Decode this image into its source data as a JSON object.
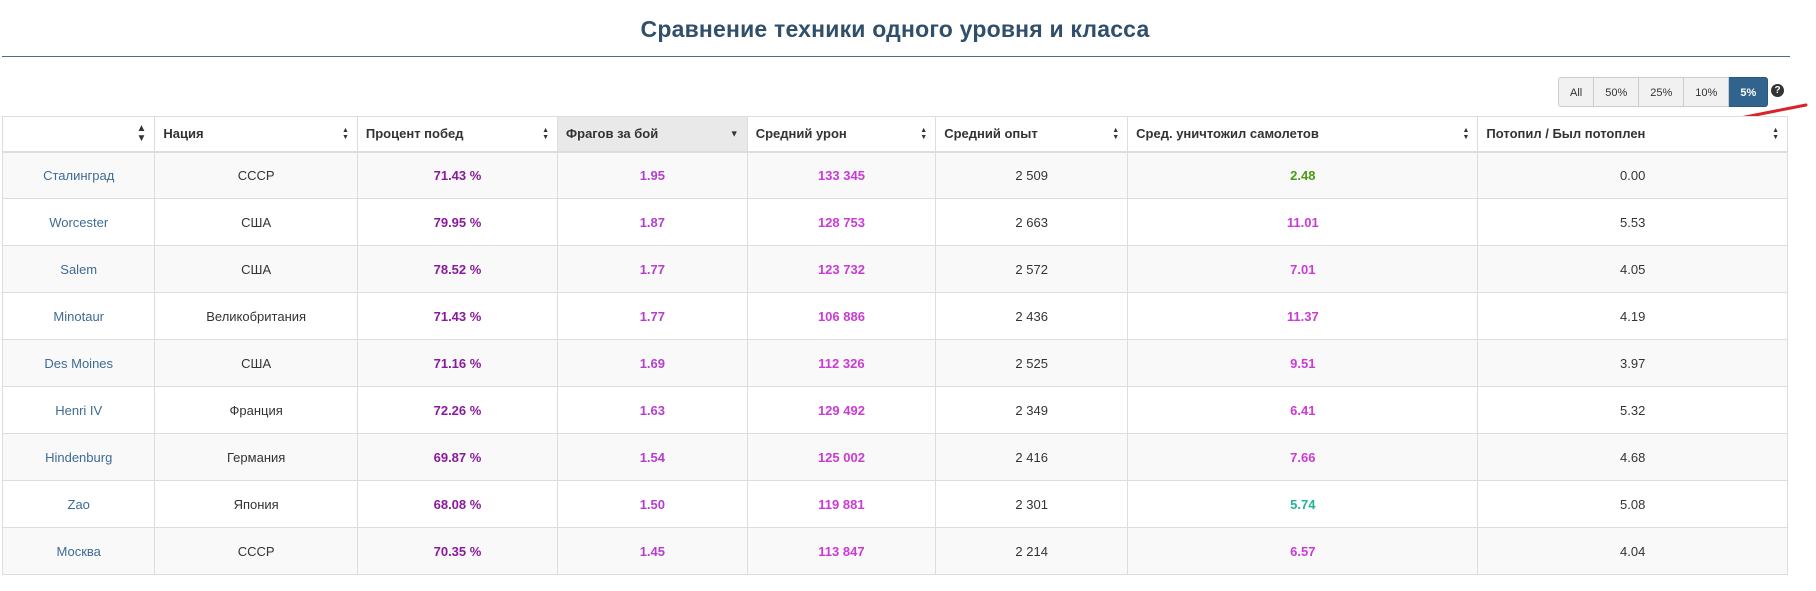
{
  "page": {
    "title": "Сравнение техники одного уровня и класса"
  },
  "filters": {
    "buttons": [
      {
        "label": "All",
        "active": false
      },
      {
        "label": "50%",
        "active": false
      },
      {
        "label": "25%",
        "active": false
      },
      {
        "label": "10%",
        "active": false
      },
      {
        "label": "5%",
        "active": true
      }
    ],
    "help_icon": "question-circle-icon",
    "help_glyph": "?"
  },
  "colors": {
    "title": "#2f4f6b",
    "active_filter": "#30648f",
    "winrate": "#8a1a9c",
    "frags": "#b53ecf",
    "damage": "#cc3ad6",
    "planes_green": "#4d9b12",
    "planes_teal": "#20b596",
    "planes_magenta": "#cc3ad6",
    "link": "#3d6b95",
    "annotation_mark": "#d8232a"
  },
  "table": {
    "headers": [
      {
        "label": "",
        "sort": "both"
      },
      {
        "label": "Нация",
        "sort": "both"
      },
      {
        "label": "Процент побед",
        "sort": "both"
      },
      {
        "label": "Фрагов за бой",
        "sort": "desc",
        "sorted": true
      },
      {
        "label": "Средний урон",
        "sort": "both"
      },
      {
        "label": "Средний опыт",
        "sort": "both"
      },
      {
        "label": "Сред. уничтожил самолетов",
        "sort": "both"
      },
      {
        "label": "Потопил / Был потоплен",
        "sort": "both"
      }
    ],
    "rows": [
      {
        "ship": "Сталинград",
        "nation": "СССР",
        "winrate": "71.43 %",
        "frags": "1.95",
        "damage": "133 345",
        "xp": "2 509",
        "planes": "2.48",
        "planes_color": "green",
        "kd": "0.00"
      },
      {
        "ship": "Worcester",
        "nation": "США",
        "winrate": "79.95 %",
        "frags": "1.87",
        "damage": "128 753",
        "xp": "2 663",
        "planes": "11.01",
        "planes_color": "magenta",
        "kd": "5.53"
      },
      {
        "ship": "Salem",
        "nation": "США",
        "winrate": "78.52 %",
        "frags": "1.77",
        "damage": "123 732",
        "xp": "2 572",
        "planes": "7.01",
        "planes_color": "magenta",
        "kd": "4.05"
      },
      {
        "ship": "Minotaur",
        "nation": "Великобритания",
        "winrate": "71.43 %",
        "frags": "1.77",
        "damage": "106 886",
        "xp": "2 436",
        "planes": "11.37",
        "planes_color": "magenta",
        "kd": "4.19"
      },
      {
        "ship": "Des Moines",
        "nation": "США",
        "winrate": "71.16 %",
        "frags": "1.69",
        "damage": "112 326",
        "xp": "2 525",
        "planes": "9.51",
        "planes_color": "magenta",
        "kd": "3.97"
      },
      {
        "ship": "Henri IV",
        "nation": "Франция",
        "winrate": "72.26 %",
        "frags": "1.63",
        "damage": "129 492",
        "xp": "2 349",
        "planes": "6.41",
        "planes_color": "magenta",
        "kd": "5.32"
      },
      {
        "ship": "Hindenburg",
        "nation": "Германия",
        "winrate": "69.87 %",
        "frags": "1.54",
        "damage": "125 002",
        "xp": "2 416",
        "planes": "7.66",
        "planes_color": "magenta",
        "kd": "4.68"
      },
      {
        "ship": "Zao",
        "nation": "Япония",
        "winrate": "68.08 %",
        "frags": "1.50",
        "damage": "119 881",
        "xp": "2 301",
        "planes": "5.74",
        "planes_color": "teal",
        "kd": "5.08"
      },
      {
        "ship": "Москва",
        "nation": "СССР",
        "winrate": "70.35 %",
        "frags": "1.45",
        "damage": "113 847",
        "xp": "2 214",
        "planes": "6.57",
        "planes_color": "magenta",
        "kd": "4.04"
      }
    ]
  }
}
